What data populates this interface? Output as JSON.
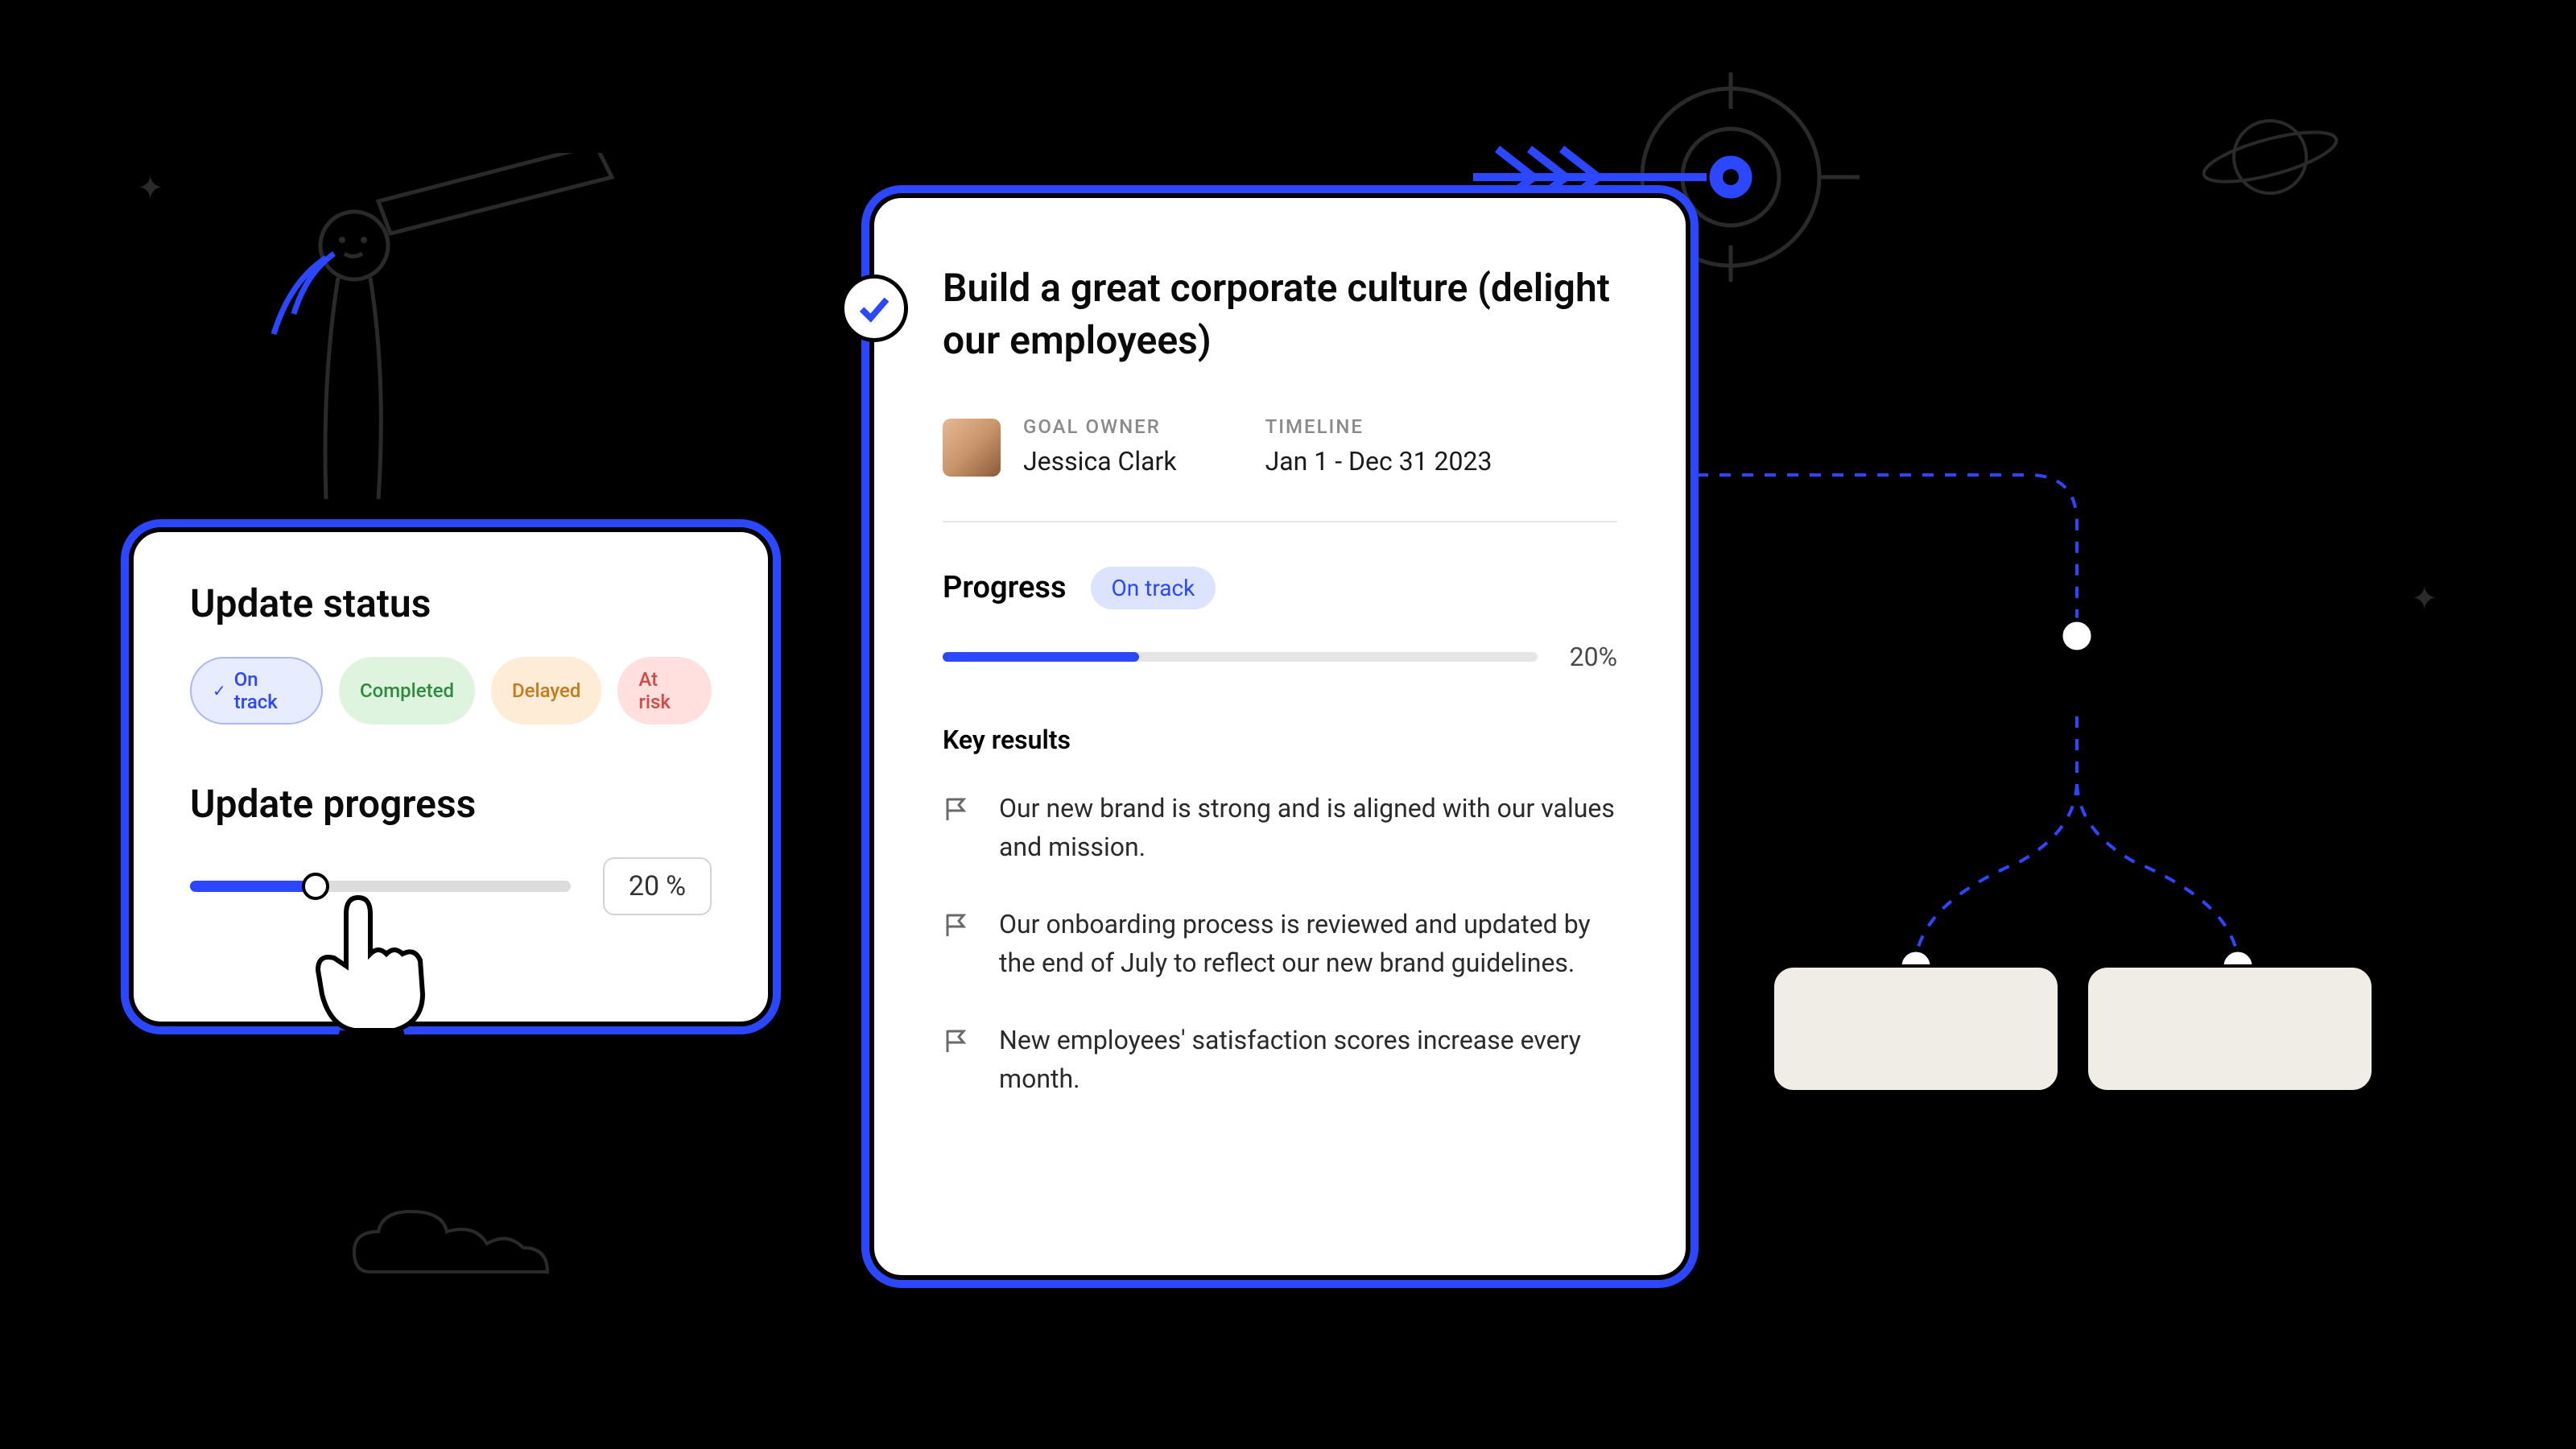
{
  "update_card": {
    "status_title": "Update status",
    "progress_title": "Update progress",
    "pills": {
      "on_track": "On track",
      "completed": "Completed",
      "delayed": "Delayed",
      "at_risk": "At risk"
    },
    "progress_value": "20",
    "progress_unit": "%"
  },
  "goal_card": {
    "title": "Build a great corporate culture (delight our employees)",
    "owner_label": "GOAL OWNER",
    "owner_name": "Jessica Clark",
    "timeline_label": "TIMELINE",
    "timeline_value": "Jan 1 - Dec 31 2023",
    "progress_label": "Progress",
    "progress_badge": "On track",
    "progress_pct": "20%",
    "kr_label": "Key results",
    "key_results": [
      "Our new brand is strong and is aligned with our values and mission.",
      "Our onboarding process is reviewed and updated by the end of July to reflect our new brand guidelines.",
      "New employees' satisfaction scores increase every month."
    ]
  }
}
